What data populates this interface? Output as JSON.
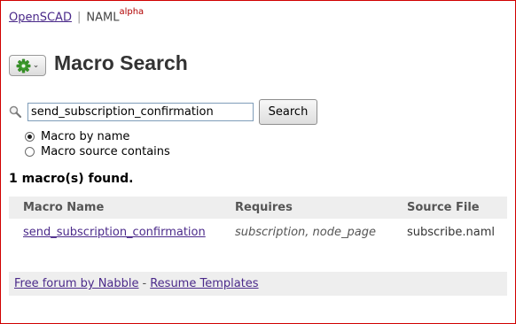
{
  "topnav": {
    "home_link": "OpenSCAD",
    "separator": "|",
    "naml_label": "NAML",
    "naml_sup": "alpha"
  },
  "header": {
    "title": "Macro Search",
    "menu_button_icon": "gear-icon",
    "menu_button_chevron": "chevron-down-icon",
    "gear_color": "#3a9a2a"
  },
  "search": {
    "value": "send_subscription_confirmation",
    "button_label": "Search",
    "icon": "search-icon"
  },
  "options": [
    {
      "label": "Macro by name",
      "selected": true
    },
    {
      "label": "Macro source contains",
      "selected": false
    }
  ],
  "results": {
    "summary": "1 macro(s) found.",
    "columns": [
      "Macro Name",
      "Requires",
      "Source File"
    ],
    "rows": [
      {
        "name": "send_subscription_confirmation",
        "requires": "subscription, node_page",
        "source": "subscribe.naml"
      }
    ]
  },
  "footer": {
    "link1": "Free forum by Nabble",
    "separator": "-",
    "link2": "Resume Templates"
  },
  "colors": {
    "link": "#4b2a8a",
    "frame_border": "#d00000",
    "alpha": "#b00000"
  }
}
